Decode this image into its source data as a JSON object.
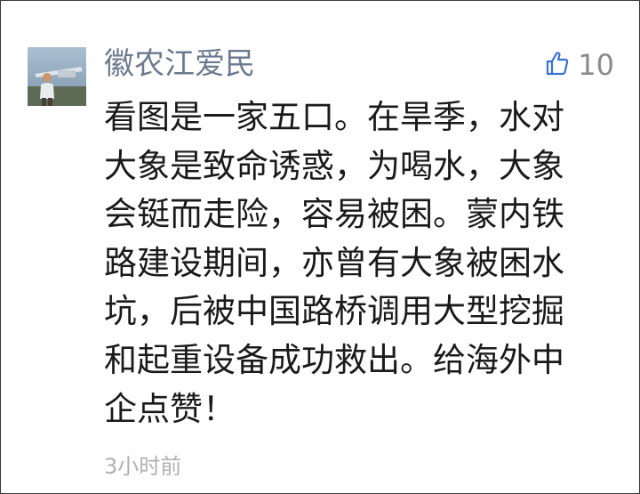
{
  "comment": {
    "author": "徽农江爱民",
    "likes": "10",
    "text_lines": [
      "看图是一家五口。在旱季，水对",
      "大象是致命诱惑，为喝水，大象",
      "会铤而走险，容易被困。蒙内铁",
      "路建设期间，亦曾有大象被困水",
      "坑，后被中国路桥调用大型挖掘",
      "和起重设备成功救出。给海外中",
      "企点赞！"
    ],
    "time": "3小时前"
  },
  "colors": {
    "author": "#6b7a8f",
    "like_icon": "#3b6fd8",
    "text": "#1a1a1a",
    "meta": "#b0b0b0"
  },
  "icons": {
    "like": "thumbs-up-icon"
  }
}
